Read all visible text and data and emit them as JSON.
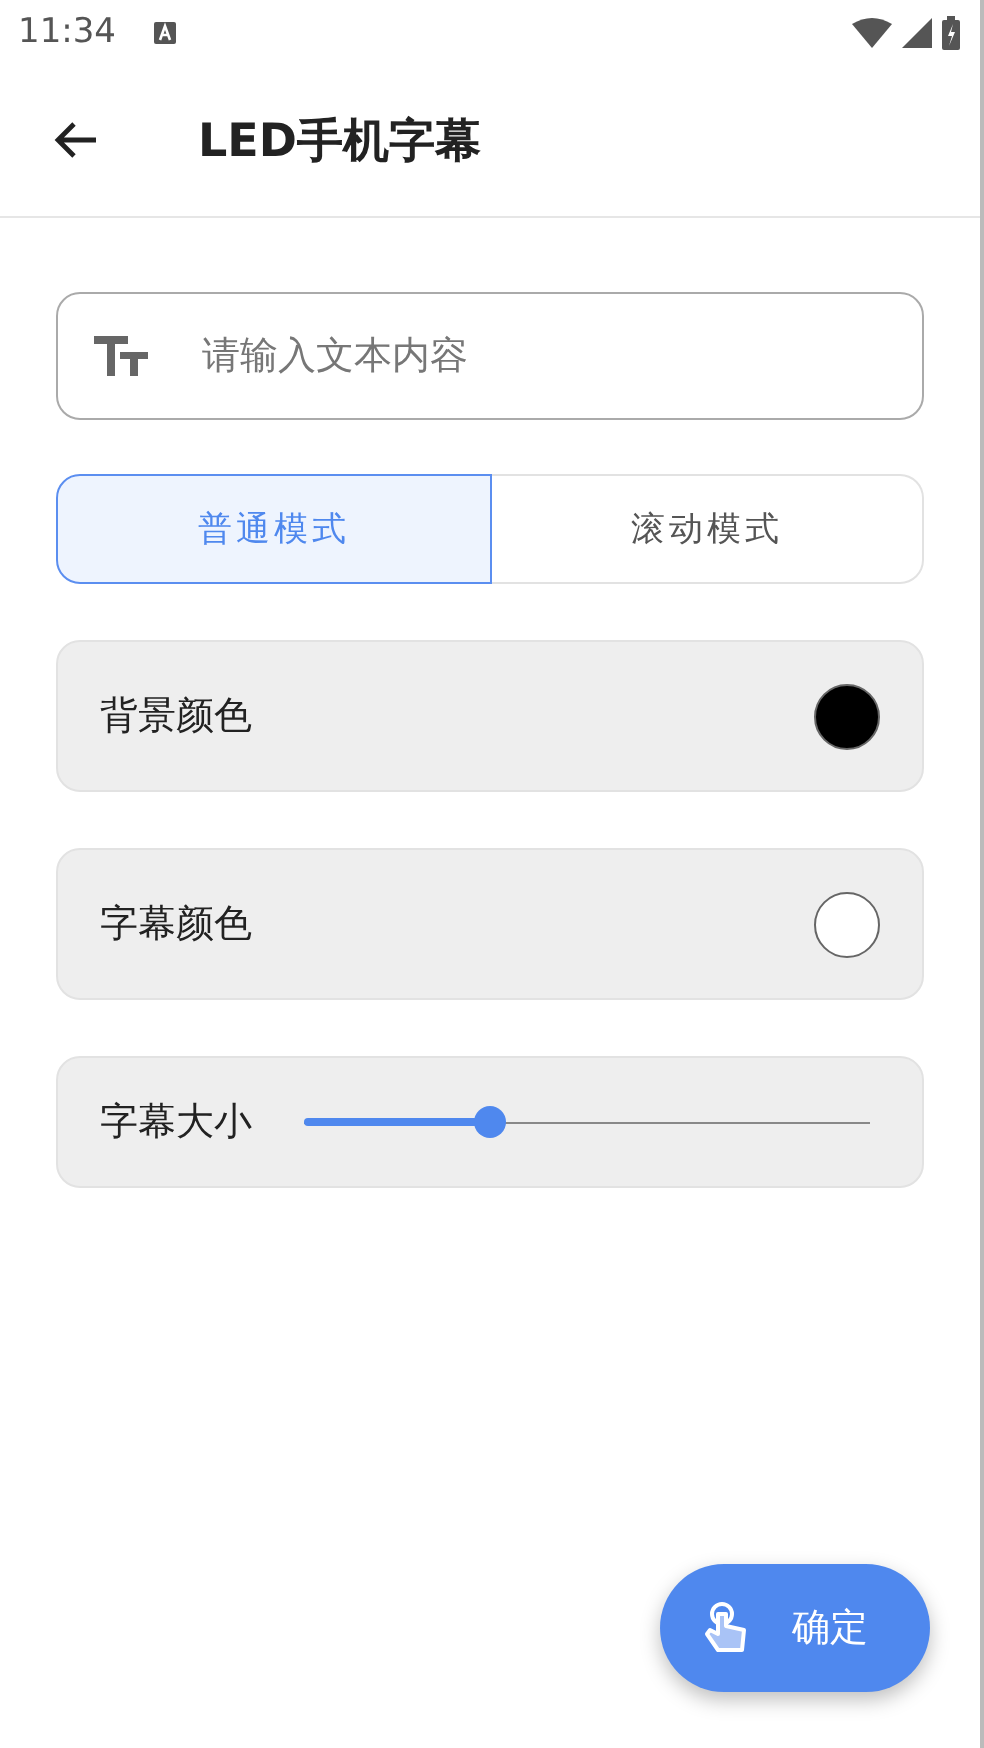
{
  "status_bar": {
    "time": "11:34"
  },
  "toolbar": {
    "title": "LED手机字幕"
  },
  "text_input": {
    "placeholder": "请输入文本内容"
  },
  "mode_tabs": [
    {
      "label": "普通模式",
      "selected": true
    },
    {
      "label": "滚动模式",
      "selected": false
    }
  ],
  "settings": [
    {
      "kind": "color",
      "label": "背景颜色",
      "color": "#000000"
    },
    {
      "kind": "color",
      "label": "字幕颜色",
      "color": "#ffffff"
    },
    {
      "kind": "slider",
      "label": "字幕大小",
      "level": 0.33
    }
  ],
  "confirm_button": {
    "label": "确定"
  }
}
